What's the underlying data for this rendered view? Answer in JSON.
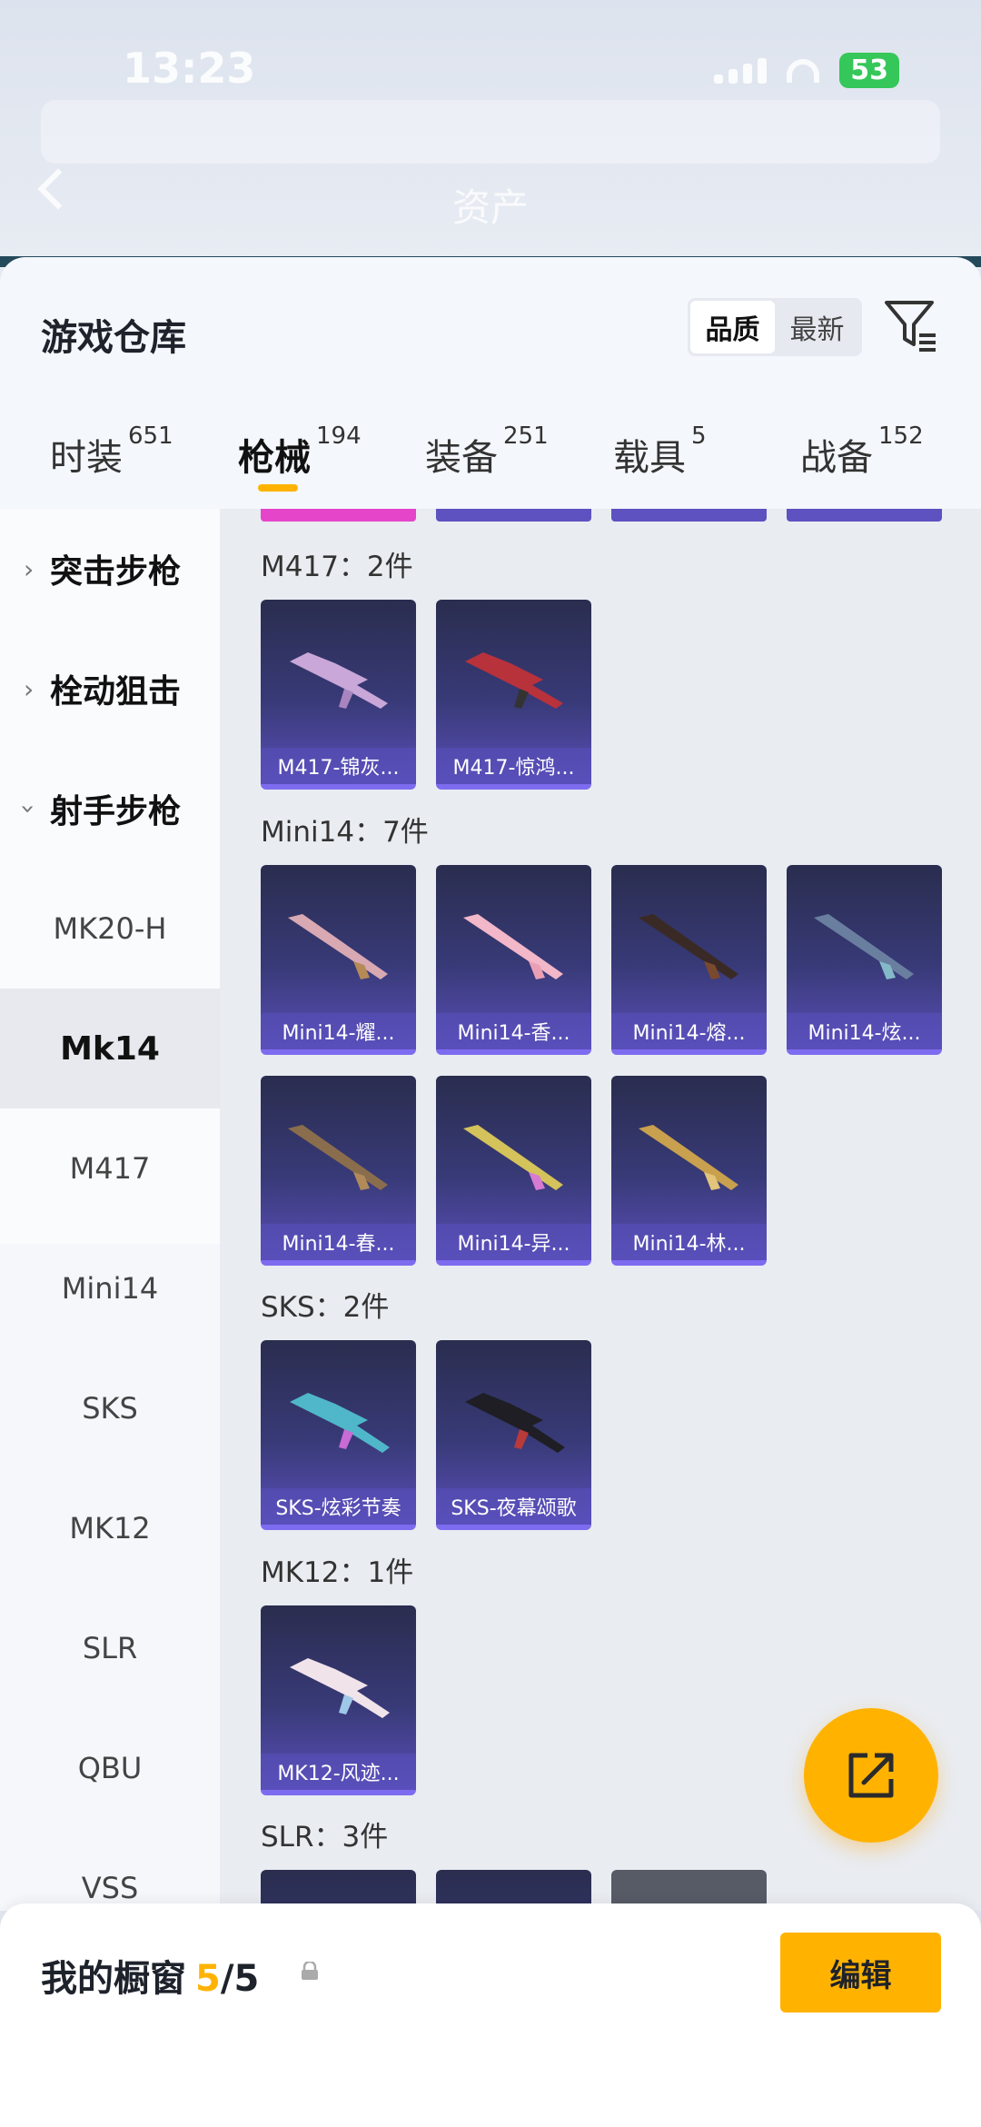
{
  "status": {
    "time": "13:23",
    "battery": "53"
  },
  "nav": {
    "title": "资产"
  },
  "header": {
    "title": "游戏仓库",
    "sort_options": [
      "品质",
      "最新"
    ],
    "sort_selected": "品质"
  },
  "tabs": [
    {
      "label": "时装",
      "count": "651"
    },
    {
      "label": "枪械",
      "count": "194",
      "active": true
    },
    {
      "label": "装备",
      "count": "251"
    },
    {
      "label": "载具",
      "count": "5"
    },
    {
      "label": "战备",
      "count": "152"
    }
  ],
  "sidebar": {
    "groups": [
      {
        "label": "突击步枪"
      },
      {
        "label": "栓动狙击"
      },
      {
        "label": "射手步枪"
      }
    ],
    "items": [
      {
        "label": "MK20-H"
      },
      {
        "label": "Mk14",
        "selected": true
      },
      {
        "label": "M417"
      },
      {
        "label": "Mini14"
      },
      {
        "label": "SKS"
      },
      {
        "label": "MK12"
      },
      {
        "label": "SLR"
      },
      {
        "label": "QBU"
      },
      {
        "label": "VSS"
      }
    ]
  },
  "sections": [
    {
      "label": "M417：2件",
      "items": [
        "M417-锦灰...",
        "M417-惊鸿..."
      ]
    },
    {
      "label": "Mini14：7件",
      "items": [
        "Mini14-耀...",
        "Mini14-香...",
        "Mini14-熔...",
        "Mini14-炫...",
        "Mini14-春...",
        "Mini14-异...",
        "Mini14-林..."
      ]
    },
    {
      "label": "SKS：2件",
      "items": [
        "SKS-炫彩节奏",
        "SKS-夜幕颂歌"
      ]
    },
    {
      "label": "MK12：1件",
      "items": [
        "MK12-风迹..."
      ]
    },
    {
      "label": "SLR：3件",
      "items": []
    }
  ],
  "bottom": {
    "label": "我的橱窗",
    "count": "5",
    "total": "/5",
    "edit_label": "编辑"
  },
  "colors": {
    "accent": "#ffb300",
    "card_top": "#2a2d4e",
    "card_bottom": "#5b4fb8"
  }
}
